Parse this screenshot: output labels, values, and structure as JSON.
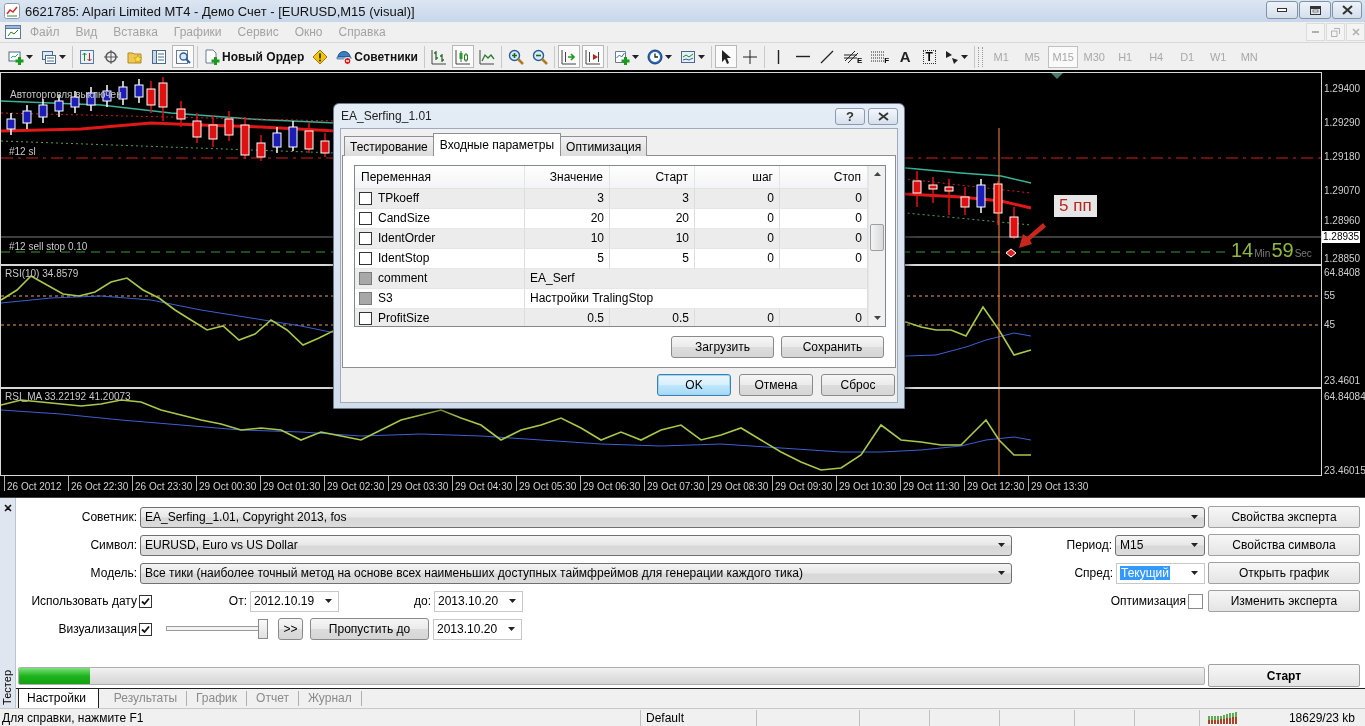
{
  "window": {
    "title": "6621785: Alpari Limited MT4 - Демо Счет - [EURUSD,M15 (visual)]"
  },
  "menu": {
    "items": [
      {
        "label": "Файл",
        "disabled": true
      },
      {
        "label": "Вид",
        "disabled": true
      },
      {
        "label": "Вставка",
        "disabled": true
      },
      {
        "label": "Графики",
        "disabled": true
      },
      {
        "label": "Сервис",
        "disabled": true
      },
      {
        "label": "Окно",
        "disabled": true
      },
      {
        "label": "Справка",
        "disabled": true
      }
    ]
  },
  "toolbar": {
    "groups": [
      {
        "buttons": [
          {
            "kind": "new-chart",
            "dropdown": true,
            "selected": false
          },
          {
            "kind": "profiles",
            "dropdown": true,
            "selected": false
          }
        ]
      },
      {
        "buttons": [
          {
            "kind": "market-watch",
            "dropdown": false,
            "selected": false
          },
          {
            "kind": "data-window",
            "dropdown": false,
            "selected": false
          },
          {
            "kind": "navigator",
            "dropdown": false,
            "selected": false
          },
          {
            "kind": "terminal",
            "dropdown": false,
            "selected": false
          },
          {
            "kind": "tester",
            "dropdown": false,
            "selected": true
          }
        ]
      },
      {
        "buttons": [
          {
            "kind": "new-order",
            "label": "Новый Ордер",
            "dropdown": false,
            "selected": false
          },
          {
            "kind": "warning",
            "dropdown": false,
            "selected": false
          },
          {
            "kind": "experts",
            "label": "Советники",
            "dropdown": false,
            "selected": false
          }
        ]
      },
      {
        "buttons": [
          {
            "kind": "bar-chart",
            "dropdown": false,
            "selected": false
          },
          {
            "kind": "candles",
            "dropdown": false,
            "selected": true
          },
          {
            "kind": "line-chart",
            "dropdown": false,
            "selected": false
          }
        ]
      },
      {
        "buttons": [
          {
            "kind": "zoom-in",
            "dropdown": false,
            "selected": false
          },
          {
            "kind": "zoom-out",
            "dropdown": false,
            "selected": false
          }
        ]
      },
      {
        "buttons": [
          {
            "kind": "autoscroll",
            "dropdown": false,
            "selected": true
          },
          {
            "kind": "chart-shift",
            "dropdown": false,
            "selected": true
          }
        ]
      },
      {
        "buttons": [
          {
            "kind": "indicators",
            "dropdown": true,
            "selected": false
          },
          {
            "kind": "periods",
            "dropdown": true,
            "selected": false
          },
          {
            "kind": "templates",
            "dropdown": true,
            "selected": false
          }
        ]
      },
      {
        "buttons": [
          {
            "kind": "cursor",
            "dropdown": false,
            "selected": true
          },
          {
            "kind": "crosshair",
            "dropdown": false,
            "selected": false
          }
        ]
      },
      {
        "buttons": [
          {
            "kind": "vertical-line",
            "dropdown": false,
            "selected": false
          },
          {
            "kind": "horizontal-line",
            "dropdown": false,
            "selected": false
          },
          {
            "kind": "trend-line",
            "dropdown": false,
            "selected": false
          },
          {
            "kind": "fibo-hatched",
            "glyph": "E",
            "dropdown": false,
            "selected": false
          },
          {
            "kind": "fibo-dotted",
            "glyph": "F",
            "dropdown": false,
            "selected": false
          },
          {
            "kind": "text",
            "glyph": "A",
            "dropdown": false,
            "selected": false
          },
          {
            "kind": "text-label",
            "glyph": "T",
            "dropdown": false,
            "selected": false
          },
          {
            "kind": "arrows",
            "dropdown": true,
            "selected": false
          }
        ]
      }
    ],
    "timeframes": [
      {
        "label": "M1",
        "selected": false,
        "disabled": true
      },
      {
        "label": "M5",
        "selected": false,
        "disabled": true
      },
      {
        "label": "M15",
        "selected": true,
        "disabled": true
      },
      {
        "label": "M30",
        "selected": false,
        "disabled": true
      },
      {
        "label": "H1",
        "selected": false,
        "disabled": true
      },
      {
        "label": "H4",
        "selected": false,
        "disabled": true
      },
      {
        "label": "D1",
        "selected": false,
        "disabled": true
      },
      {
        "label": "W1",
        "selected": false,
        "disabled": true
      },
      {
        "label": "MN",
        "selected": false,
        "disabled": true
      }
    ]
  },
  "chart": {
    "notice": "Автоторговля выключен",
    "order_labels": [
      "#12 sl",
      "#12 sell stop 0.10"
    ],
    "price_scale": [
      "1.29400",
      "1.29290",
      "1.29180",
      "1.29070",
      "1.28960",
      "1.28850"
    ],
    "current_price": "1.28935",
    "callout": "5 пп",
    "timer": {
      "minutes": "14",
      "minutes_unit": "Min",
      "seconds": "59",
      "seconds_unit": "Sec"
    },
    "indicator_panes": [
      {
        "title": "RSI(10) 34.8579",
        "scale": [
          "64.8408",
          "55",
          "45",
          "23.4601"
        ]
      },
      {
        "title": "RSI_MA 33.22192 41.20073",
        "scale": [
          "64.84084",
          "23.46015"
        ]
      }
    ],
    "time_labels": [
      "26 Oct 2012",
      "26 Oct 22:30",
      "26 Oct 23:30",
      "29 Oct 00:30",
      "29 Oct 01:30",
      "29 Oct 02:30",
      "29 Oct 03:30",
      "29 Oct 04:30",
      "29 Oct 05:30",
      "29 Oct 06:30",
      "29 Oct 07:30",
      "29 Oct 08:30",
      "29 Oct 09:30",
      "29 Oct 10:30",
      "29 Oct 11:30",
      "29 Oct 12:30",
      "29 Oct 13:30"
    ]
  },
  "dialog": {
    "title": "EA_Serfing_1.01",
    "help": "?",
    "tabs": [
      {
        "label": "Тестирование",
        "selected": false
      },
      {
        "label": "Входные параметры",
        "selected": true
      },
      {
        "label": "Оптимизация",
        "selected": false
      }
    ],
    "columns": [
      "Переменная",
      "Значение",
      "Старт",
      "шаг",
      "Стоп"
    ],
    "rows": [
      {
        "kind": "number",
        "checked": false,
        "disabled": false,
        "cells": [
          "TPkoeff",
          "3",
          "3",
          "0",
          "0"
        ]
      },
      {
        "kind": "number",
        "checked": false,
        "disabled": false,
        "cells": [
          "CandSize",
          "20",
          "20",
          "0",
          "0"
        ]
      },
      {
        "kind": "number",
        "checked": false,
        "disabled": false,
        "cells": [
          "IdentOrder",
          "10",
          "10",
          "0",
          "0"
        ]
      },
      {
        "kind": "number",
        "checked": false,
        "disabled": false,
        "cells": [
          "IdentStop",
          "5",
          "5",
          "0",
          "0"
        ]
      },
      {
        "kind": "text",
        "checked": false,
        "disabled": true,
        "cells": [
          "comment",
          "EA_Serf"
        ]
      },
      {
        "kind": "text",
        "checked": false,
        "disabled": true,
        "cells": [
          "S3",
          "Настройки TralingStop"
        ]
      },
      {
        "kind": "number",
        "checked": false,
        "disabled": false,
        "cells": [
          "ProfitSize",
          "0.5",
          "0.5",
          "0",
          "0"
        ]
      }
    ],
    "file_buttons": [
      "Загрузить",
      "Сохранить"
    ],
    "buttons": [
      {
        "label": "OK",
        "default": true
      },
      {
        "label": "Отмена",
        "default": false
      },
      {
        "label": "Сброс",
        "default": false
      }
    ]
  },
  "tester": {
    "title": "Тестер",
    "expert": {
      "label": "Советник:",
      "value": "EA_Serfing_1.01, Copyright 2013, fos"
    },
    "symbol": {
      "label": "Символ:",
      "value": "EURUSD, Euro vs US Dollar"
    },
    "period": {
      "label": "Период:",
      "value": "M15"
    },
    "model": {
      "label": "Модель:",
      "value": "Все тики (наиболее точный метод на основе всех наименьших доступных таймфреймов для генерации каждого тика)"
    },
    "spread": {
      "label": "Спред:",
      "value": "Текущий",
      "selected": true
    },
    "use_date": {
      "label": "Использовать дату",
      "checked": true
    },
    "date_from": {
      "label": "От:",
      "value": "2012.10.19"
    },
    "date_to": {
      "label": "до:",
      "value": "2013.10.20"
    },
    "optimization": {
      "label": "Оптимизация",
      "checked": false
    },
    "visualization": {
      "label": "Визуализация",
      "checked": true,
      "level": 1
    },
    "skip_button": ">>",
    "skip_to": {
      "label": "Пропустить до",
      "value": "2013.10.20"
    },
    "side_buttons": [
      "Свойства эксперта",
      "Свойства символа",
      "Открыть график",
      "Изменить эксперта"
    ],
    "progress": {
      "level": 0.06
    },
    "start_button": "Старт",
    "tabs": [
      {
        "label": "Настройки",
        "selected": true
      },
      {
        "label": "Результаты",
        "selected": false
      },
      {
        "label": "График",
        "selected": false
      },
      {
        "label": "Отчет",
        "selected": false
      },
      {
        "label": "Журнал",
        "selected": false
      }
    ]
  },
  "status_bar": {
    "help": "Для справки, нажмите F1",
    "profile": "Default",
    "traffic": "18629/23 kb"
  }
}
